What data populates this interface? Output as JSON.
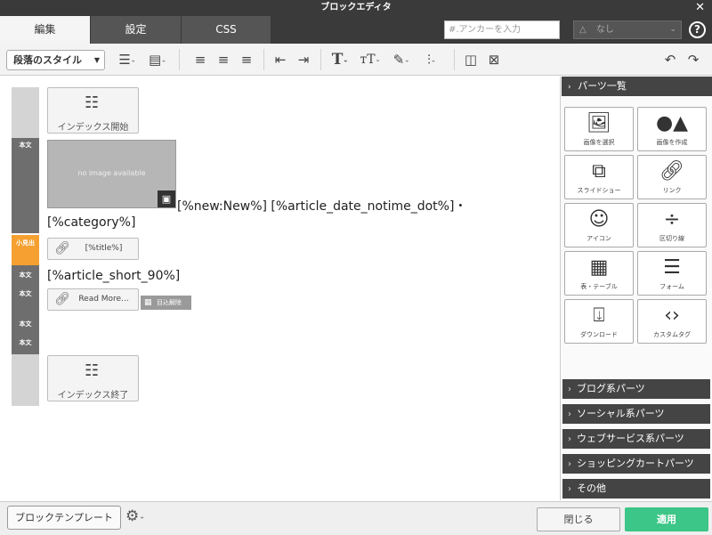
{
  "window": {
    "title": "ブロックエディタ",
    "close_glyph": "✕"
  },
  "tabs": [
    {
      "label": "編集",
      "active": true
    },
    {
      "label": "設定",
      "active": false
    },
    {
      "label": "CSS",
      "active": false
    }
  ],
  "anchor": {
    "placeholder": "#.アンカーを入力",
    "value": ""
  },
  "template_select": {
    "icon": "△",
    "label": "なし"
  },
  "help": {
    "glyph": "?"
  },
  "toolbar": {
    "paragraph_style": "段落のスタイル"
  },
  "content": {
    "rail_labels": {
      "body": "本文",
      "heading": "小見出"
    },
    "index_start": "インデックス開始",
    "index_end": "インデックス終了",
    "no_image": "no image available",
    "line1": "[%new:New%] [%article_date_notime_dot%]・",
    "line2": "[%category%]",
    "title_link": "[%title%]",
    "line3": "[%article_short_90%]",
    "read_more": "Read More...",
    "badge": "目込解除"
  },
  "right_panel": {
    "parts_header": "パーツ一覧",
    "parts": [
      {
        "label": "画像を選択",
        "icon": "image-select-icon"
      },
      {
        "label": "画像を作成",
        "icon": "image-create-icon"
      },
      {
        "label": "スライドショー",
        "icon": "slideshow-icon"
      },
      {
        "label": "リンク",
        "icon": "link-icon"
      },
      {
        "label": "アイコン",
        "icon": "smiley-icon"
      },
      {
        "label": "区切り線",
        "icon": "divider-icon"
      },
      {
        "label": "表・テーブル",
        "icon": "table-icon"
      },
      {
        "label": "フォーム",
        "icon": "form-icon"
      },
      {
        "label": "ダウンロード",
        "icon": "download-icon"
      },
      {
        "label": "カスタムタグ",
        "icon": "code-icon"
      }
    ],
    "accordions": [
      "ブログ系パーツ",
      "ソーシャル系パーツ",
      "ウェブサービス系パーツ",
      "ショッピングカートパーツ",
      "その他"
    ]
  },
  "bottom": {
    "block_template": "ブロックテンプレート",
    "close": "閉じる",
    "apply": "適用"
  },
  "colors": {
    "dark_bar": "#3a3a3a",
    "rail_dark": "#6e6e6e",
    "rail_orange": "#f5a030",
    "apply_green": "#3cc687"
  }
}
